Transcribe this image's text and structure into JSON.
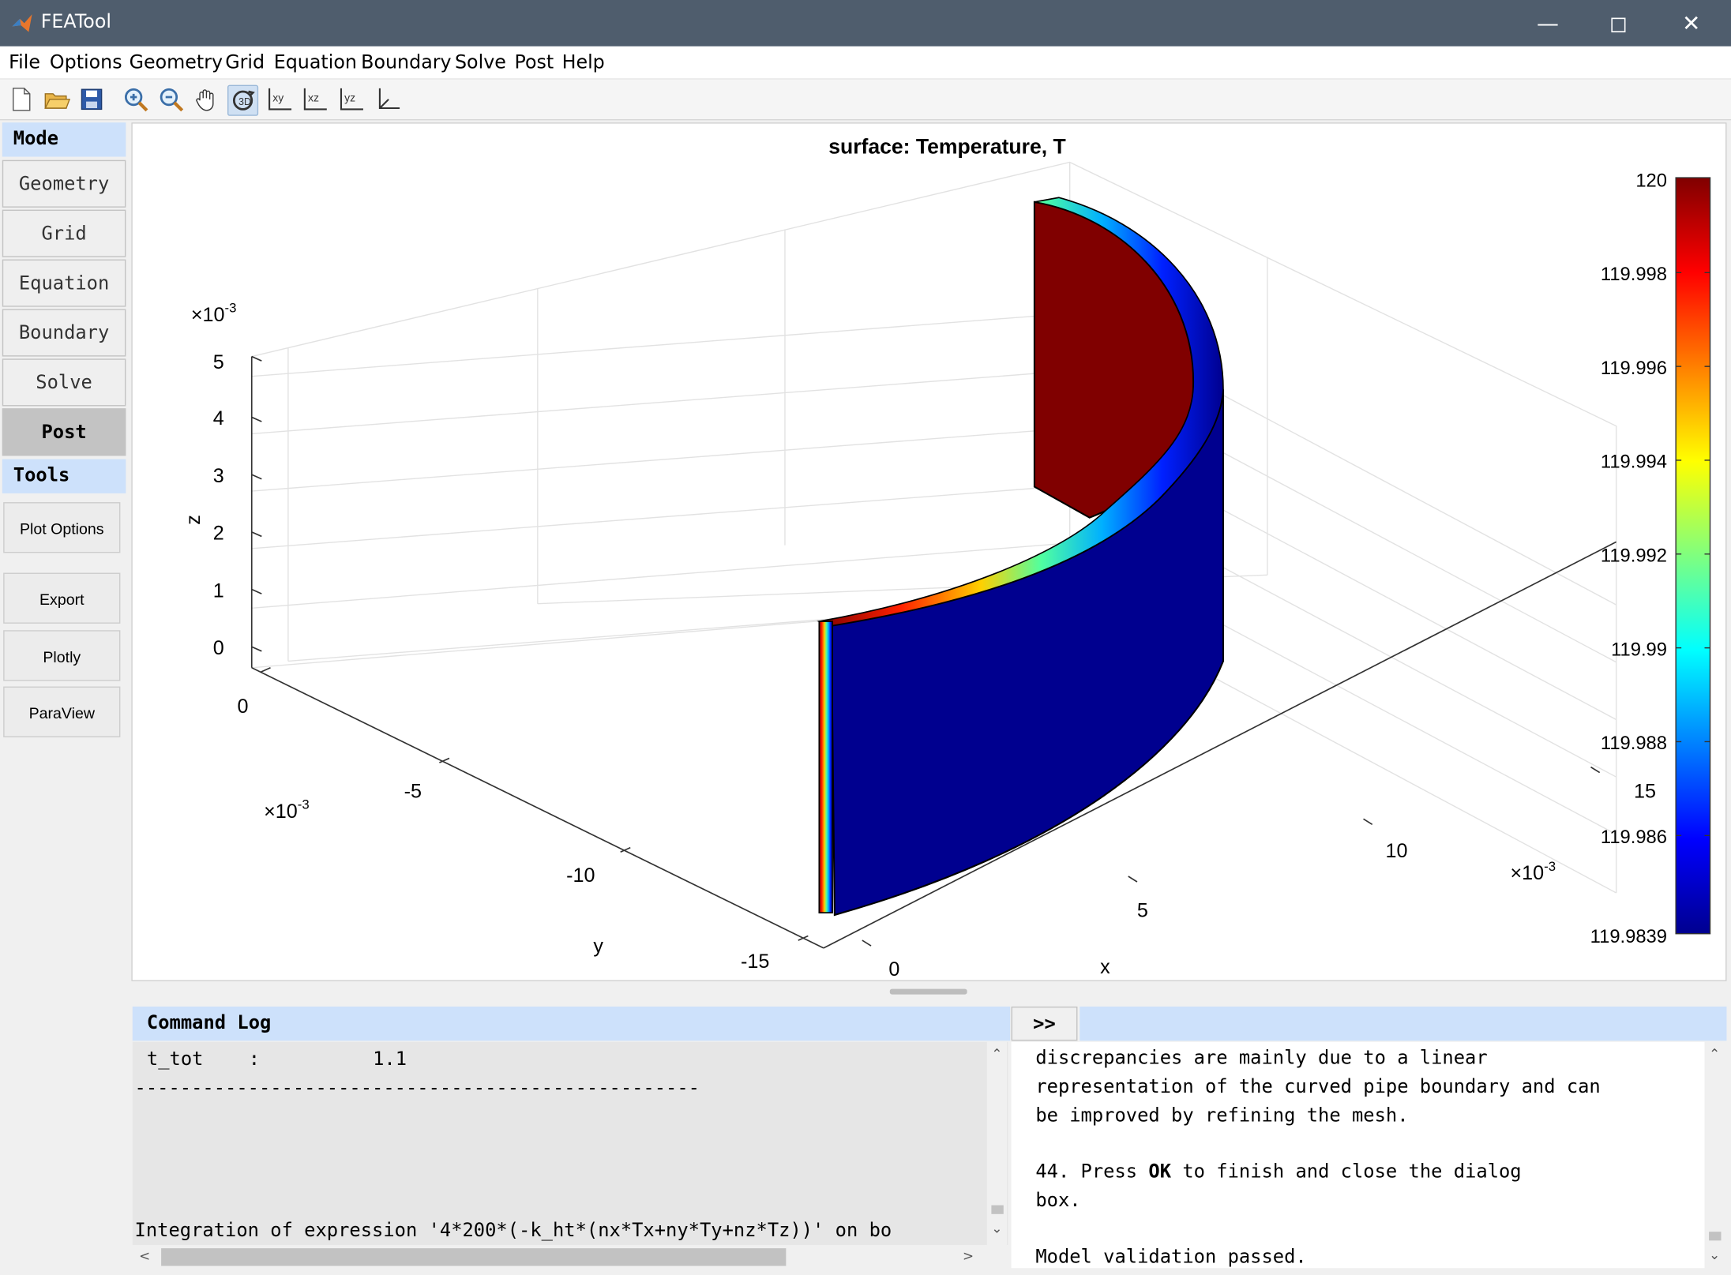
{
  "window": {
    "title": "FEATool"
  },
  "menubar": [
    "File",
    "Options",
    "Geometry",
    "Grid",
    "Equation",
    "Boundary",
    "Solve",
    "Post",
    "Help"
  ],
  "toolbar": [
    "new-file",
    "open-folder",
    "save",
    "zoom-in",
    "zoom-out",
    "pan-hand",
    "rotate-3d",
    "view-xy",
    "view-xz",
    "view-yz",
    "view-3d"
  ],
  "sidebar": {
    "mode_header": "Mode",
    "modes": [
      "Geometry",
      "Grid",
      "Equation",
      "Boundary",
      "Solve",
      "Post"
    ],
    "active_mode": "Post",
    "tools_header": "Tools",
    "tools": [
      "Plot Options",
      "Export",
      "Plotly",
      "ParaView"
    ]
  },
  "plot": {
    "title": "surface: Temperature, T",
    "xlabel": "x",
    "ylabel": "y",
    "zlabel": "z",
    "x_ticks": [
      "0",
      "5",
      "10",
      "15"
    ],
    "y_ticks": [
      "0",
      "-5",
      "-10",
      "-15"
    ],
    "z_ticks": [
      "0",
      "1",
      "2",
      "3",
      "4",
      "5"
    ],
    "x_exp": "×10",
    "y_exp": "×10",
    "z_exp": "×10",
    "exp_power": "-3",
    "colorbar_ticks": [
      "120",
      "119.998",
      "119.996",
      "119.994",
      "119.992",
      "119.99",
      "119.988",
      "119.986",
      "119.9839"
    ]
  },
  "chart_data": {
    "type": "surface",
    "title": "surface: Temperature, T",
    "xlabel": "x",
    "ylabel": "y",
    "zlabel": "z",
    "axis_scale_note": "×10^-3",
    "x_ticks": [
      0,
      5,
      10,
      15
    ],
    "y_ticks": [
      0,
      -5,
      -10,
      -15
    ],
    "z_ticks": [
      0,
      1,
      2,
      3,
      4,
      5
    ],
    "colorbar": {
      "min": 119.9839,
      "max": 120,
      "ticks": [
        120,
        119.998,
        119.996,
        119.994,
        119.992,
        119.99,
        119.988,
        119.986,
        119.9839
      ],
      "colormap": "jet"
    }
  },
  "log": {
    "header": "Command Log",
    "lines": [
      "t_tot    :          1.1",
      "--------------------------------------------------",
      "Integration of expression '4*200*(-k_ht*(nx*Tx+ny*Ty+nz*Tz))' on bo"
    ]
  },
  "toggle_label": ">>",
  "help": {
    "lines": [
      "discrepancies are mainly due to a linear",
      "representation of the curved pipe boundary and can",
      "be improved by refining the mesh.",
      "",
      "44. Press ",
      "box.",
      "",
      "Model validation passed."
    ],
    "ok_bold": "OK",
    "step44_rest": " to finish and close the dialog"
  },
  "colors": {
    "titlebar": "#4f5d6d",
    "panel_header": "#cde1fb",
    "surface_low": "#00008f",
    "surface_high": "#800000"
  }
}
